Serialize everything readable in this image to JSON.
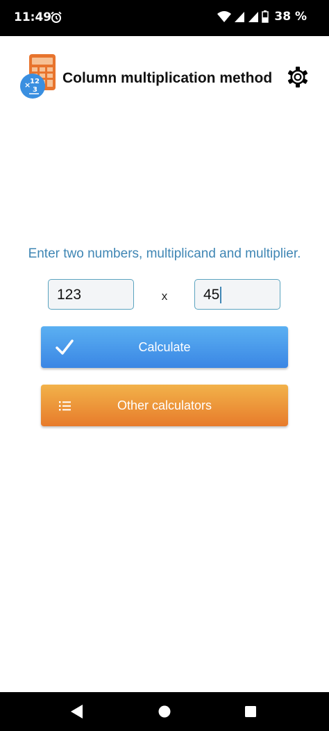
{
  "status_bar": {
    "time": "11:49",
    "battery": "38 %",
    "icons": [
      "alarm-icon",
      "wifi-icon",
      "signal-icon",
      "signal-icon",
      "battery-icon"
    ]
  },
  "header": {
    "title": "Column multiplication method",
    "logo_icon": "calculator-icon",
    "settings_icon": "gear-icon"
  },
  "main": {
    "instruction": "Enter two numbers, multiplicand and multiplier.",
    "multiplicand": "123",
    "operator": "x",
    "multiplier": "45",
    "calculate_label": "Calculate",
    "calculate_icon": "check-icon",
    "other_label": "Other calculators",
    "other_icon": "list-icon"
  },
  "colors": {
    "accent_text": "#3f86b4",
    "calculate_button": "#4a9beb",
    "other_button": "#ec9539"
  },
  "nav_bar": {
    "icons": [
      "back-icon",
      "home-icon",
      "recents-icon"
    ]
  }
}
